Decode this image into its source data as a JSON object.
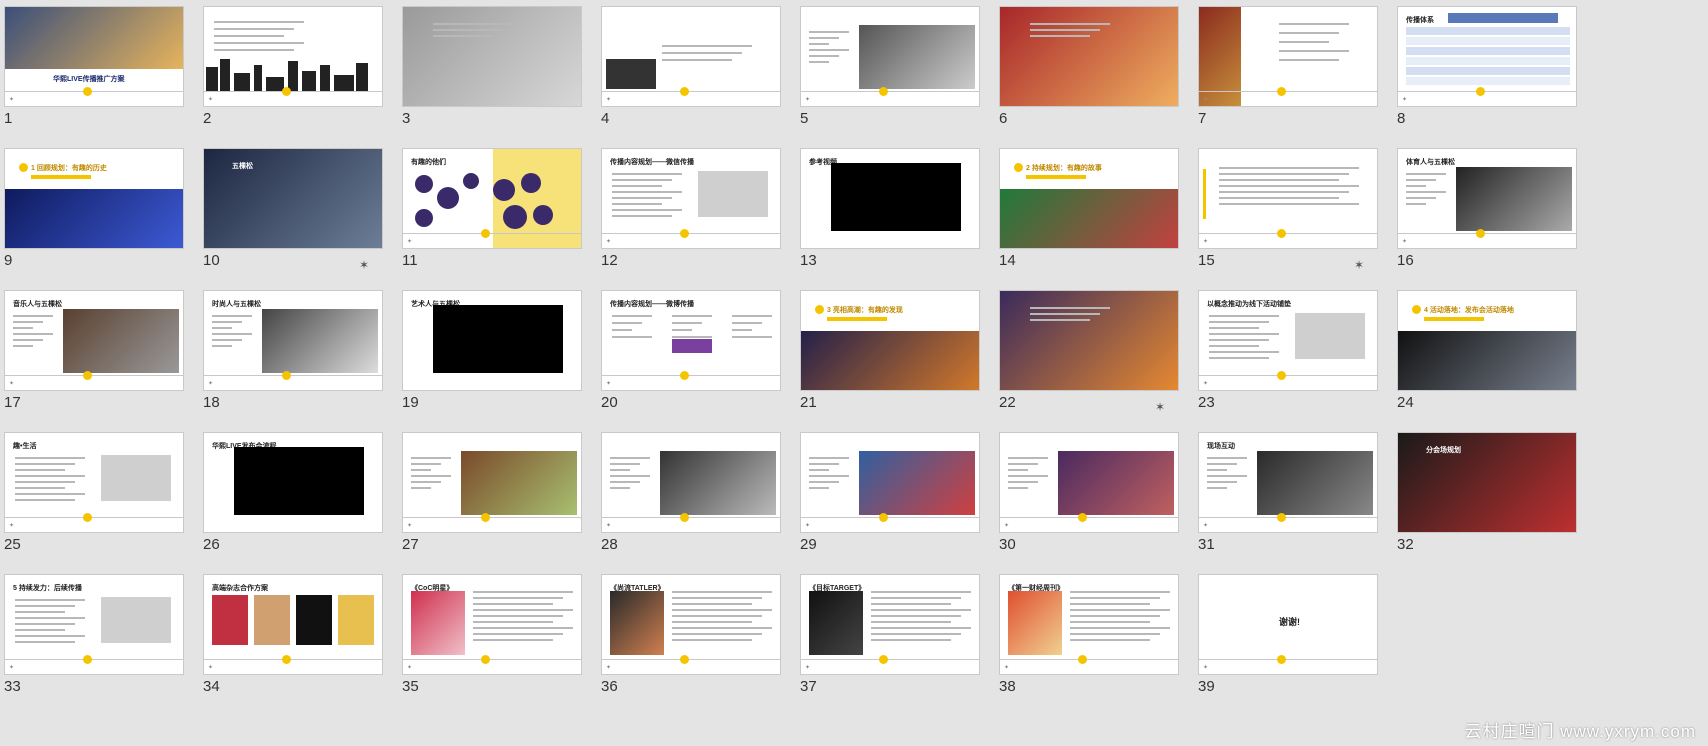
{
  "watermark": "云村庄喧门 www.yxrym.com",
  "slides": [
    {
      "n": "1",
      "kind": "cover",
      "title": "华熙LIVE传播推广方案",
      "c1": "#3b4f7a",
      "c2": "#e8b55c"
    },
    {
      "n": "2",
      "kind": "skyline",
      "title": ""
    },
    {
      "n": "3",
      "kind": "photo",
      "title": "",
      "c1": "#9a9a9a",
      "c2": "#d8d8d8"
    },
    {
      "n": "4",
      "kind": "temple",
      "title": ""
    },
    {
      "n": "5",
      "kind": "photoRight",
      "title": "",
      "c1": "#555",
      "c2": "#ccc"
    },
    {
      "n": "6",
      "kind": "photo",
      "title": "",
      "c1": "#a8262a",
      "c2": "#f0b060"
    },
    {
      "n": "7",
      "kind": "photoLeft",
      "title": "",
      "c1": "#8b2b1e",
      "c2": "#c8913c"
    },
    {
      "n": "8",
      "kind": "table",
      "title": "传播体系"
    },
    {
      "n": "9",
      "kind": "section",
      "title": "1 回顾规划：有趣的历史",
      "c1": "#0f1a5e",
      "c2": "#3d5bd6"
    },
    {
      "n": "10",
      "kind": "dark",
      "title": "五棵松",
      "c1": "#1c2640",
      "c2": "#6e7f98",
      "star": true
    },
    {
      "n": "11",
      "kind": "circles",
      "title": "有趣的他们"
    },
    {
      "n": "12",
      "kind": "text",
      "title": "传播内容规划——微信传播"
    },
    {
      "n": "13",
      "kind": "video",
      "title": "参考视频"
    },
    {
      "n": "14",
      "kind": "section",
      "title": "2 持续规划：有趣的故事",
      "c1": "#1f7a3a",
      "c2": "#c54040"
    },
    {
      "n": "15",
      "kind": "quote",
      "title": "",
      "star": true
    },
    {
      "n": "16",
      "kind": "photoRight",
      "title": "体育人与五棵松",
      "c1": "#222",
      "c2": "#aaa"
    },
    {
      "n": "17",
      "kind": "photoRight",
      "title": "音乐人与五棵松",
      "c1": "#5a4030",
      "c2": "#999"
    },
    {
      "n": "18",
      "kind": "photoRight",
      "title": "时尚人与五棵松",
      "c1": "#444",
      "c2": "#ddd"
    },
    {
      "n": "19",
      "kind": "video",
      "title": "艺术人与五棵松"
    },
    {
      "n": "20",
      "kind": "flow",
      "title": "传播内容规划——微博传播"
    },
    {
      "n": "21",
      "kind": "section",
      "title": "3 亮相高潮：有趣的发现",
      "c1": "#24204a",
      "c2": "#d47a2a"
    },
    {
      "n": "22",
      "kind": "photo",
      "title": "",
      "c1": "#3a2a5c",
      "c2": "#e88a30",
      "star": true
    },
    {
      "n": "23",
      "kind": "text",
      "title": "以概念推动为线下活动铺垫"
    },
    {
      "n": "24",
      "kind": "section",
      "title": "4 活动落地：发布会活动落地",
      "c1": "#111",
      "c2": "#7a8290"
    },
    {
      "n": "25",
      "kind": "text",
      "title": "趣•生活"
    },
    {
      "n": "26",
      "kind": "video",
      "title": "华熙LIVE发布会流程"
    },
    {
      "n": "27",
      "kind": "photoRight",
      "title": "",
      "c1": "#7a4a2a",
      "c2": "#a8c070"
    },
    {
      "n": "28",
      "kind": "photoRight",
      "title": "",
      "c1": "#333",
      "c2": "#bbb"
    },
    {
      "n": "29",
      "kind": "photoRight",
      "title": "",
      "c1": "#3060a0",
      "c2": "#d04040"
    },
    {
      "n": "30",
      "kind": "photoRight",
      "title": "",
      "c1": "#4a2a60",
      "c2": "#c06060"
    },
    {
      "n": "31",
      "kind": "photoRight",
      "title": "现场互动",
      "c1": "#2a2a2a",
      "c2": "#888"
    },
    {
      "n": "32",
      "kind": "dark",
      "title": "分会场规划",
      "c1": "#1a1a1a",
      "c2": "#c03030"
    },
    {
      "n": "33",
      "kind": "text",
      "title": "5 持续发力：后续传播"
    },
    {
      "n": "34",
      "kind": "magazines",
      "title": "高端杂志合作方案"
    },
    {
      "n": "35",
      "kind": "mag",
      "title": "《CoC明星》",
      "c1": "#d03050",
      "c2": "#f0c0c8"
    },
    {
      "n": "36",
      "kind": "mag",
      "title": "《尚流TATLER》",
      "c1": "#2a2a2a",
      "c2": "#d08050"
    },
    {
      "n": "37",
      "kind": "mag",
      "title": "《目标TARGET》",
      "c1": "#111",
      "c2": "#444"
    },
    {
      "n": "38",
      "kind": "mag",
      "title": "《第一财经周刊》",
      "c1": "#e05030",
      "c2": "#f0d090"
    },
    {
      "n": "39",
      "kind": "end",
      "title": "谢谢!"
    }
  ]
}
